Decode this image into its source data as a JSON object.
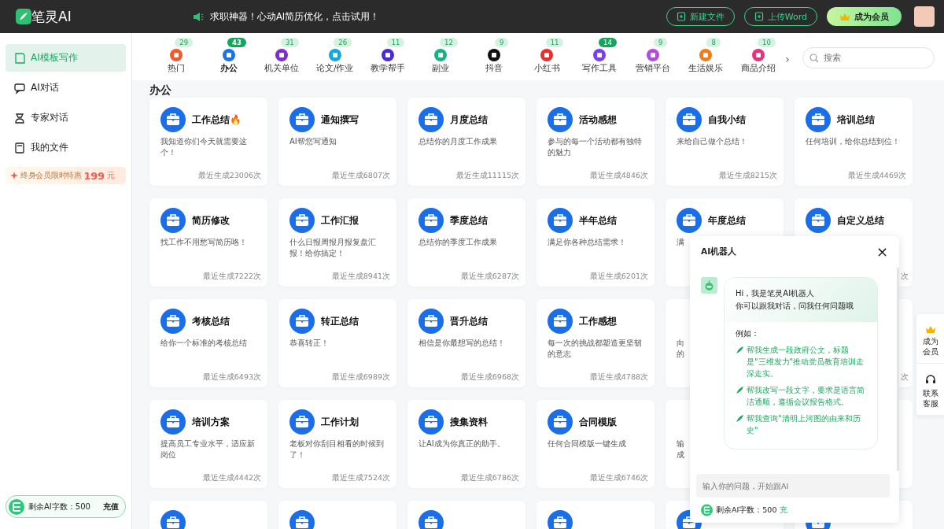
{
  "topbar": {
    "logo": "笔灵AI",
    "notice": "求职神器！心动AI简历优化，点击试用！",
    "buttons": [
      {
        "kind": "outline",
        "label": "新建文件"
      },
      {
        "kind": "outline",
        "label": "上传Word"
      },
      {
        "kind": "vip",
        "label": "成为会员"
      }
    ]
  },
  "sidebar": {
    "items": [
      {
        "label": "AI模板写作",
        "selected": true
      },
      {
        "label": "AI对话",
        "selected": false
      },
      {
        "label": "专家对话",
        "selected": false
      },
      {
        "label": "我的文件",
        "selected": false
      }
    ],
    "promo": {
      "text": "终身会员限时特惠",
      "price": "199",
      "unit": "元"
    },
    "quota": {
      "text": "剩余AI字数：500",
      "action": "充值"
    }
  },
  "categories": {
    "items": [
      {
        "label": "热门",
        "count": "29",
        "selected": false,
        "badge_strong": false,
        "color": "#f5582a"
      },
      {
        "label": "办公",
        "count": "43",
        "selected": true,
        "badge_strong": true,
        "color": "#1a73e8"
      },
      {
        "label": "机关单位",
        "count": "31",
        "selected": false,
        "badge_strong": false,
        "color": "#7b2fd1"
      },
      {
        "label": "论文/作业",
        "count": "26",
        "selected": false,
        "badge_strong": false,
        "color": "#12a9e0"
      },
      {
        "label": "教学帮手",
        "count": "11",
        "selected": false,
        "badge_strong": false,
        "color": "#4a2bd6"
      },
      {
        "label": "副业",
        "count": "12",
        "selected": false,
        "badge_strong": false,
        "color": "#19b37d"
      },
      {
        "label": "抖音",
        "count": "9",
        "selected": false,
        "badge_strong": false,
        "color": "#111111"
      },
      {
        "label": "小红书",
        "count": "11",
        "selected": false,
        "badge_strong": false,
        "color": "#e8312f"
      },
      {
        "label": "写作工具",
        "count": "14",
        "selected": false,
        "badge_strong": true,
        "color": "#7a3ff0"
      },
      {
        "label": "营销平台",
        "count": "9",
        "selected": false,
        "badge_strong": false,
        "color": "#b14be6"
      },
      {
        "label": "生活娱乐",
        "count": "8",
        "selected": false,
        "badge_strong": false,
        "color": "#f07c1a"
      },
      {
        "label": "商品介绍",
        "count": "10",
        "selected": false,
        "badge_strong": false,
        "color": "#e8337a"
      }
    ],
    "more": "›",
    "search": {
      "placeholder": "搜索"
    }
  },
  "section": {
    "title": "办公",
    "cards": [
      {
        "kind": "card",
        "title": "工作总结🔥",
        "desc": "我知道你们今天就需要这个！",
        "count": "最近生成23006次"
      },
      {
        "kind": "card",
        "title": "通知撰写",
        "desc": "AI帮您写通知",
        "count": "最近生成6807次"
      },
      {
        "kind": "card",
        "title": "月度总结",
        "desc": "总结你的月度工作成果",
        "count": "最近生成11115次"
      },
      {
        "kind": "card",
        "title": "活动感想",
        "desc": "参与的每一个活动都有独特的魅力",
        "count": "最近生成4846次"
      },
      {
        "kind": "card",
        "title": "自我小结",
        "desc": "来给自己做个总结！",
        "count": "最近生成8215次"
      },
      {
        "kind": "card",
        "title": "培训总结",
        "desc": "任何培训，给你总结到位！",
        "count": "最近生成4469次"
      },
      {
        "kind": "card",
        "title": "简历修改",
        "desc": "找工作不用愁写简历咯！",
        "count": "最近生成7222次"
      },
      {
        "kind": "card",
        "title": "工作汇报",
        "desc": "什么日报周报月报复盘汇报！给你搞定！",
        "count": "最近生成8941次"
      },
      {
        "kind": "card",
        "title": "季度总结",
        "desc": "总结你的季度工作成果",
        "count": "最近生成6287次"
      },
      {
        "kind": "card",
        "title": "半年总结",
        "desc": "满足你各种总结需求！",
        "count": "最近生成6201次"
      },
      {
        "kind": "covered",
        "title": "年度总结",
        "desc": "满"
      },
      {
        "kind": "covered",
        "title": "自定义总结",
        "count": "次"
      },
      {
        "kind": "card",
        "title": "考核总结",
        "desc": "给你一个标准的考核总结",
        "count": "最近生成6493次"
      },
      {
        "kind": "card",
        "title": "转正总结",
        "desc": "恭喜转正！",
        "count": "最近生成6989次"
      },
      {
        "kind": "card",
        "title": "晋升总结",
        "desc": "相信是你最想写的总结！",
        "count": "最近生成6968次"
      },
      {
        "kind": "card",
        "title": "工作感想",
        "desc": "每一次的挑战都塑造更坚韧的意志",
        "count": "最近生成4788次"
      },
      {
        "kind": "covered",
        "desc": "向的"
      },
      {
        "kind": "covered",
        "count": "次"
      },
      {
        "kind": "card",
        "title": "培训方案",
        "desc": "提高员工专业水平，适应新岗位",
        "count": "最近生成4442次"
      },
      {
        "kind": "card",
        "title": "工作计划",
        "desc": "老板对你刮目相看的时候到了！",
        "count": "最近生成7524次"
      },
      {
        "kind": "card",
        "title": "搜集资料",
        "desc": "让AI成为你真正的助手。",
        "count": "最近生成6786次"
      },
      {
        "kind": "card",
        "title": "合同模版",
        "desc": "任何合同模版一键生成",
        "count": "最近生成6746次"
      },
      {
        "kind": "covered",
        "desc": "输成"
      },
      {
        "kind": "covered"
      },
      {
        "kind": "cut"
      },
      {
        "kind": "cut"
      },
      {
        "kind": "cut"
      },
      {
        "kind": "cut"
      },
      {
        "kind": "cut"
      },
      {
        "kind": "cut"
      }
    ]
  },
  "chat": {
    "title": "AI机器人",
    "close": "×",
    "greeting": [
      "Hi，我是笔灵AI机器人",
      "你可以跟我对话，问我任何问题哦"
    ],
    "examples_label": "例如：",
    "examples": [
      "帮我生成一段政府公文，标题是\"三维发力\"推动党员教育培训走深走实。",
      "帮我改写一段文字，要求是语言简洁通顺，遵循会议报告格式。",
      "帮我查询\"清明上河图的由来和历史\""
    ],
    "input": {
      "placeholder": "输入你的问题，开始跟AI"
    },
    "quota": {
      "text": "剩余AI字数：500",
      "action": "充"
    }
  },
  "float": {
    "items": [
      {
        "kind": "vip",
        "label": "成为会员"
      },
      {
        "kind": "service",
        "label": "联系客服"
      }
    ]
  }
}
